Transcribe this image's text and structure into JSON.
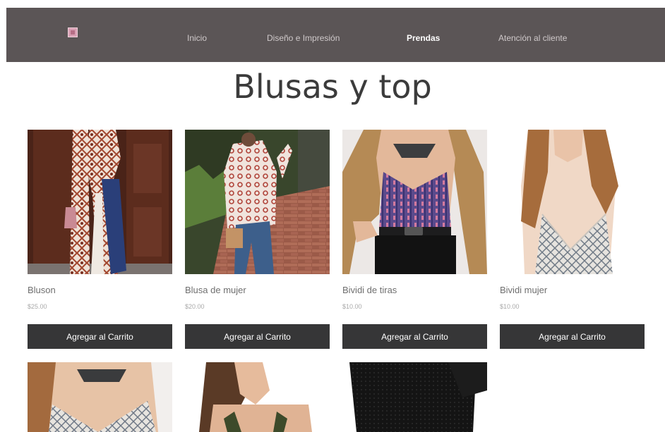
{
  "nav": {
    "logo_icon": "shop-logo-icon",
    "items": [
      {
        "label": "Inicio",
        "active": false
      },
      {
        "label": "Diseño e Impresión",
        "active": false
      },
      {
        "label": "Prendas",
        "active": true
      },
      {
        "label": "Atención al cliente",
        "active": false
      }
    ]
  },
  "page": {
    "title": "Blusas y top"
  },
  "products": [
    {
      "name": "Bluson",
      "price": "$25.00",
      "button": "Agregar al Carrito"
    },
    {
      "name": "Blusa de mujer",
      "price": "$20.00",
      "button": "Agregar al Carrito"
    },
    {
      "name": "Bividi de tiras",
      "price": "$10.00",
      "button": "Agregar al Carrito"
    },
    {
      "name": "Bividi mujer",
      "price": "$10.00",
      "button": "Agregar al Carrito"
    }
  ],
  "colors": {
    "nav_bg": "#5b5556",
    "button_bg": "#363637",
    "title_text": "#3b3b3b"
  }
}
